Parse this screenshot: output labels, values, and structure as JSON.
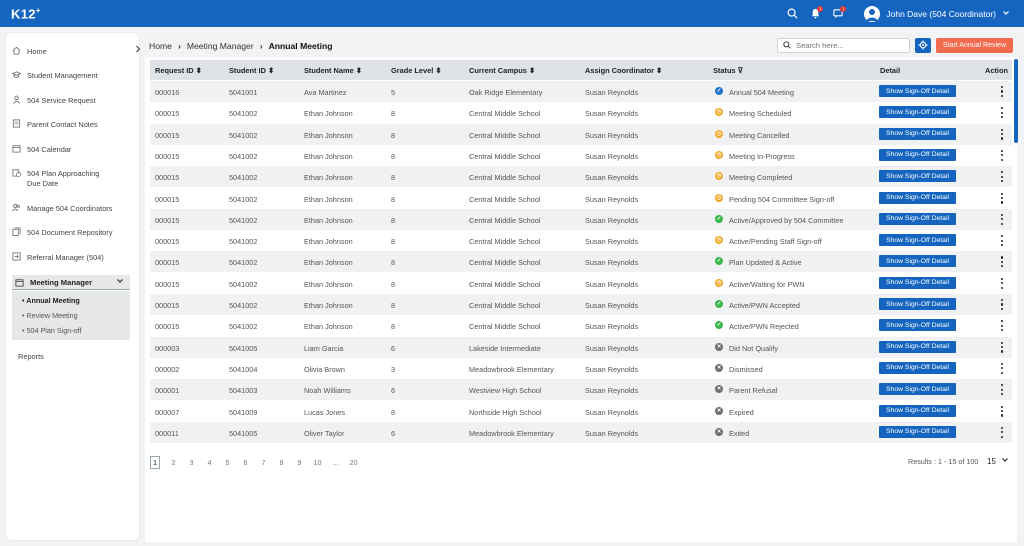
{
  "app": {
    "logo": "K12",
    "logo_sup": "+"
  },
  "topbar": {
    "user_name": "John Dave (504 Coordinator)",
    "notifications_badge": "1",
    "messages_badge": "1"
  },
  "sidebar": {
    "items": [
      {
        "label": "Home",
        "icon": "home-icon"
      },
      {
        "label": "Student Management",
        "icon": "graduation-cap-icon"
      },
      {
        "label": "504 Service Request",
        "icon": "user-icon"
      },
      {
        "label": "Parent Contact Notes",
        "icon": "notes-icon"
      },
      {
        "label": "504 Calendar",
        "icon": "calendar-icon"
      },
      {
        "label": "504 Plan Approaching Due Date",
        "icon": "calendar-clock-icon"
      },
      {
        "label": "Manage 504 Coordinators",
        "icon": "users-icon"
      },
      {
        "label": "504 Document Repository",
        "icon": "documents-icon"
      },
      {
        "label": "Referral Manager (504)",
        "icon": "referral-icon"
      }
    ],
    "meeting_manager": {
      "label": "Meeting Manager",
      "sub_items": [
        {
          "label": "Annual Meeting"
        },
        {
          "label": "Review Meeting"
        },
        {
          "label": "504 Plan Sign-off"
        }
      ]
    },
    "reports": "Reports"
  },
  "breadcrumb": {
    "home": "Home",
    "section": "Meeting Manager",
    "current": "Annual Meeting"
  },
  "search": {
    "placeholder": "Search here..."
  },
  "actions": {
    "start_review": "Start Annual Review"
  },
  "table": {
    "headers": [
      "Request ID",
      "Student ID",
      "Student Name",
      "Grade Level",
      "Current Campus",
      "Assign Coordinator",
      "Status",
      "Detail",
      "Action"
    ],
    "show_label": "Show Sign-Off Detail",
    "rows": [
      [
        "000016",
        "5041001",
        "Ava Martinez",
        "5",
        "Oak Ridge Elementary",
        "Susan Reynolds",
        "Annual 504 Meeting",
        "blue"
      ],
      [
        "000015",
        "5041002",
        "Ethan Johnson",
        "8",
        "Central Middle School",
        "Susan Reynolds",
        "Meeting Scheduled",
        "orange"
      ],
      [
        "000015",
        "5041002",
        "Ethan Johnson",
        "8",
        "Central Middle School",
        "Susan Reynolds",
        "Meeting Cancelled",
        "orange"
      ],
      [
        "000015",
        "5041002",
        "Ethan Johnson",
        "8",
        "Central Middle School",
        "Susan Reynolds",
        "Meeting In-Progress",
        "orange"
      ],
      [
        "000015",
        "5041002",
        "Ethan Johnson",
        "8",
        "Central Middle School",
        "Susan Reynolds",
        "Meeting Completed",
        "orange"
      ],
      [
        "000015",
        "5041002",
        "Ethan Johnson",
        "8",
        "Central Middle School",
        "Susan Reynolds",
        "Pending 504 Committee Sign-off",
        "orange"
      ],
      [
        "000015",
        "5041002",
        "Ethan Johnson",
        "8",
        "Central Middle School",
        "Susan Reynolds",
        "Active/Approved by 504 Committee",
        "green"
      ],
      [
        "000015",
        "5041002",
        "Ethan Johnson",
        "8",
        "Central Middle School",
        "Susan Reynolds",
        "Active/Pending Staff Sign-off",
        "orange"
      ],
      [
        "000015",
        "5041002",
        "Ethan Johnson",
        "8",
        "Central Middle School",
        "Susan Reynolds",
        "Plan Updated & Active",
        "green"
      ],
      [
        "000015",
        "5041002",
        "Ethan Johnson",
        "8",
        "Central Middle School",
        "Susan Reynolds",
        "Active/Waiting for PWN",
        "orange"
      ],
      [
        "000015",
        "5041002",
        "Ethan Johnson",
        "8",
        "Central Middle School",
        "Susan Reynolds",
        "Active/PWN Accepted",
        "green"
      ],
      [
        "000015",
        "5041002",
        "Ethan Johnson",
        "8",
        "Central Middle School",
        "Susan Reynolds",
        "Active/PWN Rejected",
        "green"
      ],
      [
        "000003",
        "5041005",
        "Liam Garcia",
        "6",
        "Lakeside Intermediate",
        "Susan Reynolds",
        "Did Not Qualify",
        "grey"
      ],
      [
        "000002",
        "5041004",
        "Olivia Brown",
        "3",
        "Meadowbrook Elementary",
        "Susan Reynolds",
        "Dismissed",
        "grey"
      ],
      [
        "000001",
        "5041003",
        "Noah Williams",
        "6",
        "Westview High School",
        "Susan Reynolds",
        "Parent Refusal",
        "grey"
      ],
      [
        "000007",
        "5041009",
        "Lucas Jones",
        "8",
        "Northside High School",
        "Susan Reynolds",
        "Expired",
        "grey"
      ],
      [
        "000011",
        "5041005",
        "Oliver Taylor",
        "6",
        "Meadowbrook Elementary",
        "Susan Reynolds",
        "Exited",
        "grey"
      ]
    ]
  },
  "status_colors": {
    "blue": "#1e73c9",
    "orange": "#f5a623",
    "green": "#3cb54a",
    "grey": "#6d6d6d"
  },
  "pagination": {
    "pages": [
      "1",
      "2",
      "3",
      "4",
      "5",
      "6",
      "7",
      "8",
      "9",
      "10",
      "...",
      "20"
    ],
    "results": "Results : 1 - 15 of 100",
    "per_page": "15"
  }
}
